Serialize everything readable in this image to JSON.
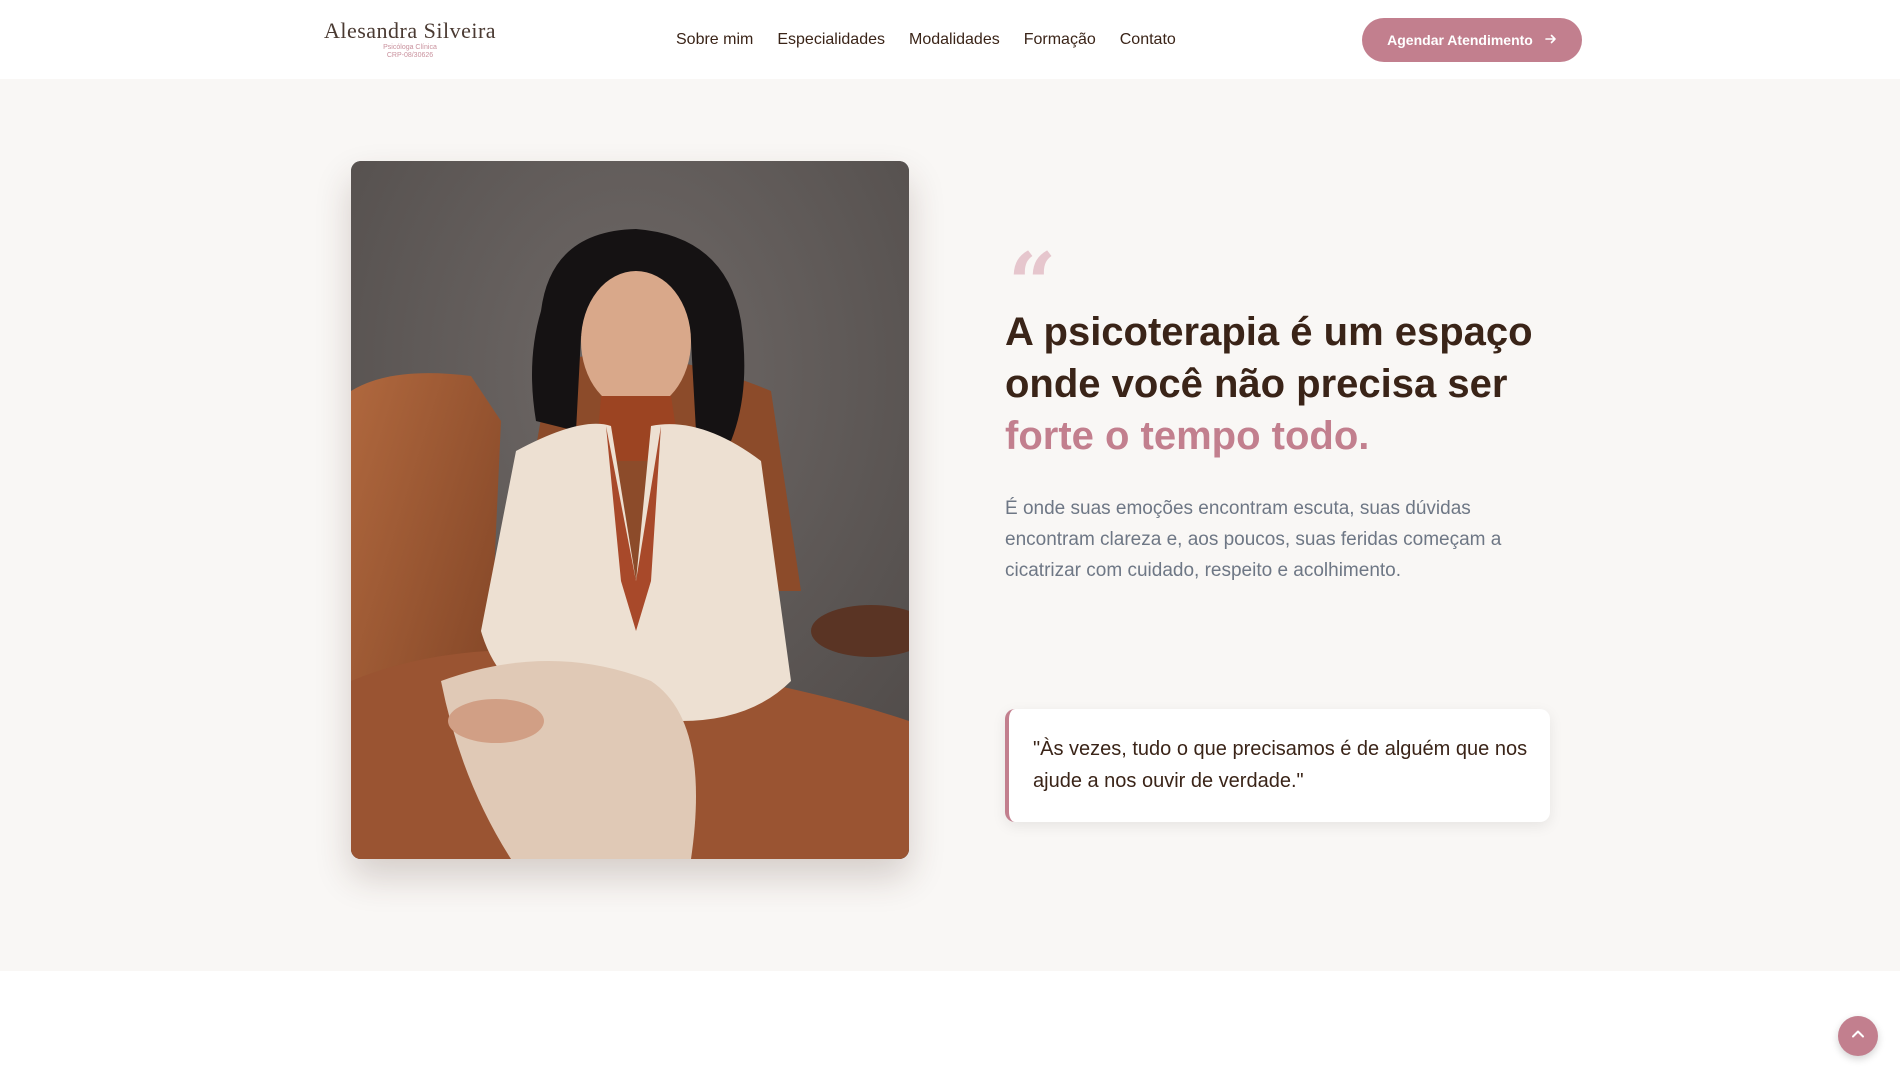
{
  "logo": {
    "name": "Alesandra Silveira",
    "subtitle": "Psicóloga Clínica",
    "crp": "CRP-08/30626"
  },
  "nav": {
    "items": [
      "Sobre mim",
      "Especialidades",
      "Modalidades",
      "Formação",
      "Contato"
    ]
  },
  "cta": {
    "label": "Agendar Atendimento",
    "icon": "arrow-right-icon"
  },
  "hero": {
    "photo_icon": "psychologist-portrait",
    "quote_mark": "“",
    "headline_main": "A psicoterapia é um espaço onde você não precisa ser ",
    "headline_accent": "forte o tempo todo.",
    "lead": "É onde suas emoções encontram escuta, suas dúvidas encontram clareza e, aos poucos, suas feridas começam a cicatrizar com cuidado, respeito e acolhimento.",
    "quote": "\"Às vezes, tudo o que precisamos é de alguém que nos ajude a nos ouvir de verdade.\""
  },
  "scroll_top": {
    "icon": "chevron-up-icon"
  },
  "colors": {
    "accent": "#c27f8e",
    "text": "#3a2418",
    "muted": "#6e7785",
    "section_bg": "#f9f7f5"
  }
}
